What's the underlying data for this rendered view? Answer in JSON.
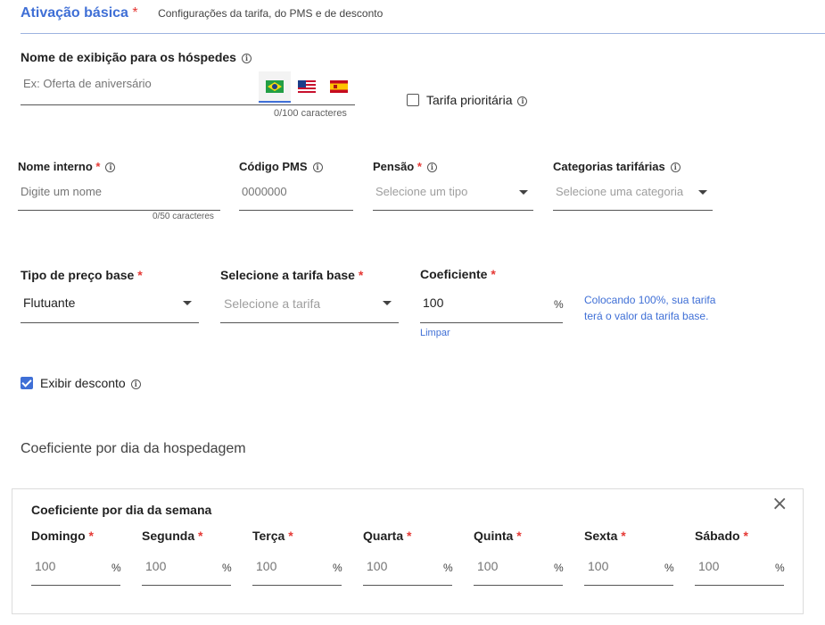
{
  "section": {
    "title": "Ativação básica",
    "required_mark": "*",
    "subtitle": "Configurações da tarifa, do PMS e de desconto"
  },
  "display_name": {
    "label": "Nome de exibição para os hóspedes",
    "placeholder": "Ex: Oferta de aniversário",
    "counter": "0/100 caracteres",
    "languages": [
      "pt-BR",
      "en-US",
      "es-ES"
    ],
    "active_language": "pt-BR"
  },
  "priority_rate": {
    "label": "Tarifa prioritária",
    "checked": false
  },
  "internal_name": {
    "label": "Nome interno",
    "required_mark": "*",
    "placeholder": "Digite um nome",
    "counter": "0/50 caracteres"
  },
  "pms_code": {
    "label": "Código PMS",
    "placeholder": "0000000"
  },
  "board": {
    "label": "Pensão",
    "required_mark": "*",
    "placeholder": "Selecione um tipo"
  },
  "rate_categories": {
    "label": "Categorias tarifárias",
    "placeholder": "Selecione uma categoria"
  },
  "base_price_type": {
    "label": "Tipo de preço base",
    "required_mark": "*",
    "value": "Flutuante"
  },
  "base_rate": {
    "label": "Selecione a tarifa base",
    "required_mark": "*",
    "placeholder": "Selecione a tarifa"
  },
  "coefficient": {
    "label": "Coeficiente",
    "required_mark": "*",
    "value": "100",
    "unit": "%",
    "clear_link": "Limpar",
    "hint_line1": "Colocando 100%, sua tarifa",
    "hint_line2": "terá o valor da tarifa base."
  },
  "show_discount": {
    "label": "Exibir desconto",
    "checked": true
  },
  "stay_day_coefficient": {
    "title": "Coeficiente por dia da hospedagem"
  },
  "weekday_coefficient": {
    "title": "Coeficiente por dia da semana",
    "close_label": "×",
    "days": [
      {
        "label": "Domingo",
        "required_mark": "*",
        "placeholder": "100",
        "unit": "%"
      },
      {
        "label": "Segunda",
        "required_mark": "*",
        "placeholder": "100",
        "unit": "%"
      },
      {
        "label": "Terça",
        "required_mark": "*",
        "placeholder": "100",
        "unit": "%"
      },
      {
        "label": "Quarta",
        "required_mark": "*",
        "placeholder": "100",
        "unit": "%"
      },
      {
        "label": "Quinta",
        "required_mark": "*",
        "placeholder": "100",
        "unit": "%"
      },
      {
        "label": "Sexta",
        "required_mark": "*",
        "placeholder": "100",
        "unit": "%"
      },
      {
        "label": "Sábado",
        "required_mark": "*",
        "placeholder": "100",
        "unit": "%"
      }
    ]
  },
  "colors": {
    "accent": "#3f6fd6",
    "required": "#e53935",
    "divider": "#9db3e0"
  }
}
